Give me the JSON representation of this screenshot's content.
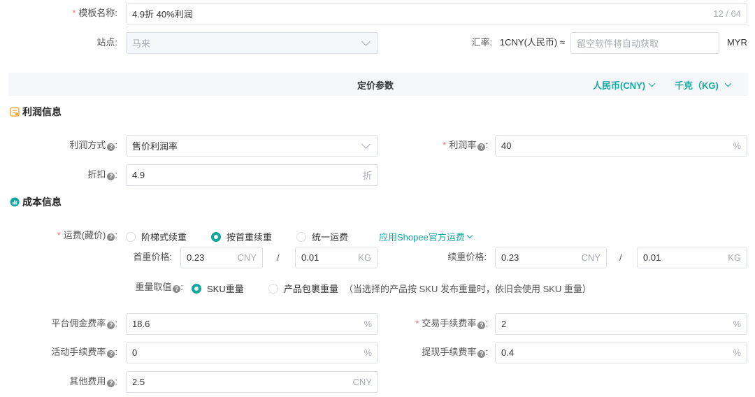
{
  "template": {
    "label": "模板名称:",
    "value": "4.9折   40%利润",
    "count": "12 / 64"
  },
  "site": {
    "label": "站点:",
    "value": "马来"
  },
  "exchange": {
    "label": "汇率:",
    "prefix": "1CNY(人民币) ≈",
    "placeholder": "留空软件将自动获取",
    "unit": "MYR"
  },
  "pricing_header": {
    "title": "定价参数",
    "currency": "人民币(CNY)",
    "weight_unit": "千克（KG)"
  },
  "profit_section": {
    "title": "利润信息",
    "method_label": "利润方式",
    "method_value": "售价利润率",
    "rate_label": "利润率",
    "rate_value": "40",
    "rate_suffix": "%",
    "discount_label": "折扣",
    "discount_value": "4.9",
    "discount_suffix": "折"
  },
  "cost_section": {
    "title": "成本信息",
    "shipping_label": "运费(藏价)",
    "shipping_options": [
      "阶梯式续重",
      "按首重续重",
      "统一运费"
    ],
    "shipping_selected": 1,
    "shopee_link": "应用Shopee官方运费",
    "first_price_label": "首重价格:",
    "first_price_value": "0.23",
    "first_price_unit": "CNY",
    "first_weight_value": "0.01",
    "first_weight_unit": "KG",
    "slash": "/",
    "cont_price_label": "续重价格:",
    "cont_price_value": "0.23",
    "cont_price_unit": "CNY",
    "cont_weight_value": "0.01",
    "cont_weight_unit": "KG",
    "weight_source_label": "重量取值",
    "weight_options": [
      "SKU重量",
      "产品包裹重量"
    ],
    "weight_selected": 0,
    "weight_note": "（当选择的产品按 SKU 发布重量时，依旧会使用 SKU 重量）",
    "commission_label": "平台佣金费率",
    "commission_value": "18.6",
    "transaction_label": "交易手续费率",
    "transaction_value": "2",
    "activity_label": "活动手续费率",
    "activity_value": "0",
    "withdraw_label": "提现手续费率",
    "withdraw_value": "0.4",
    "other_label": "其他费用",
    "other_value": "2.5",
    "other_unit": "CNY",
    "percent": "%"
  },
  "colors": {
    "accent": "#13a89e",
    "required": "#f56c6c",
    "header_bg": "#f5f7fa",
    "profit_icon": "#f0a020"
  }
}
